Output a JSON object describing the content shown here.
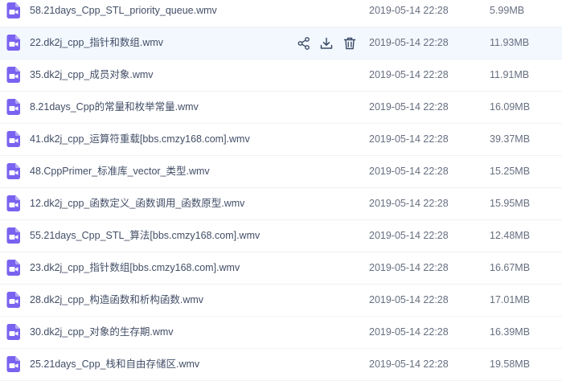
{
  "icons": {
    "file_type": "video-file-icon",
    "actions": [
      "share-icon",
      "download-icon",
      "delete-icon"
    ]
  },
  "colors": {
    "video_icon": "#7a62f0",
    "hover_row": "#f2f8fe",
    "action_icon": "#3b4a66"
  },
  "files": [
    {
      "name": "58.21days_Cpp_STL_priority_queue.wmv",
      "date": "2019-05-14 22:28",
      "size": "5.99MB"
    },
    {
      "name": "22.dk2j_cpp_指针和数组.wmv",
      "date": "2019-05-14 22:28",
      "size": "11.93MB",
      "hovered": true
    },
    {
      "name": "35.dk2j_cpp_成员对象.wmv",
      "date": "2019-05-14 22:28",
      "size": "11.91MB"
    },
    {
      "name": "8.21days_Cpp的常量和枚举常量.wmv",
      "date": "2019-05-14 22:28",
      "size": "16.09MB"
    },
    {
      "name": "41.dk2j_cpp_运算符重载[bbs.cmzy168.com].wmv",
      "date": "2019-05-14 22:28",
      "size": "39.37MB"
    },
    {
      "name": "48.CppPrimer_标准库_vector_类型.wmv",
      "date": "2019-05-14 22:28",
      "size": "15.25MB"
    },
    {
      "name": "12.dk2j_cpp_函数定义_函数调用_函数原型.wmv",
      "date": "2019-05-14 22:28",
      "size": "15.95MB"
    },
    {
      "name": "55.21days_Cpp_STL_算法[bbs.cmzy168.com].wmv",
      "date": "2019-05-14 22:28",
      "size": "12.48MB"
    },
    {
      "name": "23.dk2j_cpp_指针数组[bbs.cmzy168.com].wmv",
      "date": "2019-05-14 22:28",
      "size": "16.67MB"
    },
    {
      "name": "28.dk2j_cpp_构造函数和析构函数.wmv",
      "date": "2019-05-14 22:28",
      "size": "17.01MB"
    },
    {
      "name": "30.dk2j_cpp_对象的生存期.wmv",
      "date": "2019-05-14 22:28",
      "size": "16.39MB"
    },
    {
      "name": "25.21days_Cpp_栈和自由存储区.wmv",
      "date": "2019-05-14 22:28",
      "size": "19.58MB"
    }
  ]
}
